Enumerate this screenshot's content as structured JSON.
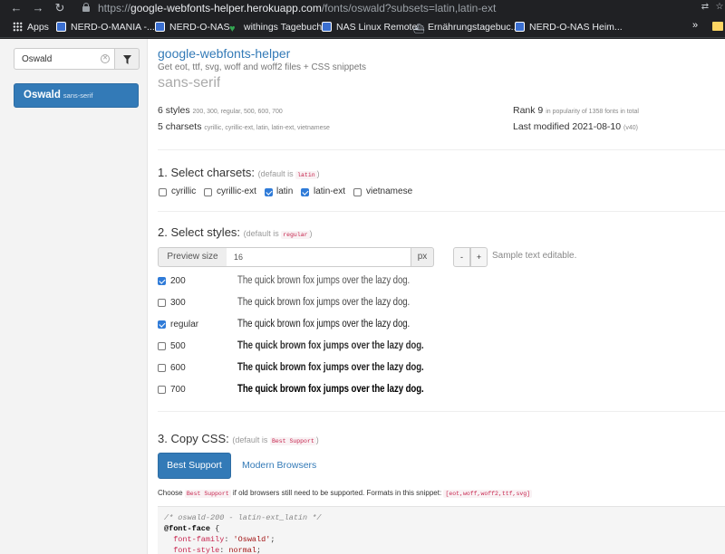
{
  "browser": {
    "url_prefix": "https://",
    "url_host": "google-webfonts-helper.herokuapp.com",
    "url_path": "/fonts/oswald?subsets=latin,latin-ext"
  },
  "bookmarks": {
    "items": [
      {
        "label": "Apps",
        "icon": "apps-grid-icon"
      },
      {
        "label": "NERD-O-MANIA -...",
        "icon": "nerd-icon"
      },
      {
        "label": "NERD-O-NAS",
        "icon": "nerd-icon"
      },
      {
        "label": "withings Tagebuch",
        "icon": "heart-icon"
      },
      {
        "label": "NAS Linux Remote",
        "icon": "nerd-icon"
      },
      {
        "label": "Ernährungstagebuc...",
        "icon": "ship-icon"
      },
      {
        "label": "NERD-O-NAS Heim...",
        "icon": "nerd-icon"
      }
    ],
    "more": "»"
  },
  "sidebar": {
    "search_value": "Oswald",
    "selected_font": {
      "name": "Oswald",
      "category": "sans-serif"
    }
  },
  "header": {
    "title": "google-webfonts-helper",
    "subtitle": "Get eot, ttf, svg, woff and woff2 files + CSS snippets",
    "category": "sans-serif"
  },
  "font_info": {
    "styles_count": "6 styles",
    "styles_list": "200, 300, regular, 500, 600, 700",
    "charsets_count": "5 charsets",
    "charsets_list": "cyrillic, cyrillic-ext, latin, latin-ext, vietnamese",
    "rank": "Rank 9",
    "rank_note": "in popularity of 1358 fonts in total",
    "last_modified": "Last modified 2021-08-10",
    "version": "(v40)"
  },
  "charsets_section": {
    "heading": "1. Select charsets:",
    "default_prefix": "(default is",
    "default_value": "latin",
    "default_suffix": ")",
    "options": [
      {
        "label": "cyrillic",
        "checked": false
      },
      {
        "label": "cyrillic-ext",
        "checked": false
      },
      {
        "label": "latin",
        "checked": true
      },
      {
        "label": "latin-ext",
        "checked": true
      },
      {
        "label": "vietnamese",
        "checked": false
      }
    ]
  },
  "styles_section": {
    "heading": "2. Select styles:",
    "default_prefix": "(default is",
    "default_value": "regular",
    "default_suffix": ")",
    "preview_label": "Preview size",
    "preview_value": "16",
    "preview_unit": "px",
    "minus": "-",
    "plus": "+",
    "sample_note": "Sample text editable.",
    "sample_text": "The quick brown fox jumps over the lazy dog.",
    "styles": [
      {
        "label": "200",
        "checked": true
      },
      {
        "label": "300",
        "checked": false
      },
      {
        "label": "regular",
        "checked": true
      },
      {
        "label": "500",
        "checked": false
      },
      {
        "label": "600",
        "checked": false
      },
      {
        "label": "700",
        "checked": false
      }
    ]
  },
  "css_section": {
    "heading": "3. Copy CSS:",
    "default_prefix": "(default is",
    "default_value": "Best Support",
    "default_suffix": ")",
    "best_support_button": "Best Support",
    "modern_browsers_link": "Modern Browsers",
    "choose_prefix": "Choose",
    "choose_tag": "Best Support",
    "choose_middle": "if old browsers still need to be supported. Formats in this snippet:",
    "choose_formats": "[eot,woff,woff2,ttf,svg]",
    "code_comment": "/* oswald-200 - latin-ext_latin */",
    "code_rule": "@font-face",
    "code_brace": " {",
    "code_prop1": "font-family",
    "code_val1": "'Oswald'",
    "code_prop2": "font-style",
    "code_val2": "normal"
  }
}
